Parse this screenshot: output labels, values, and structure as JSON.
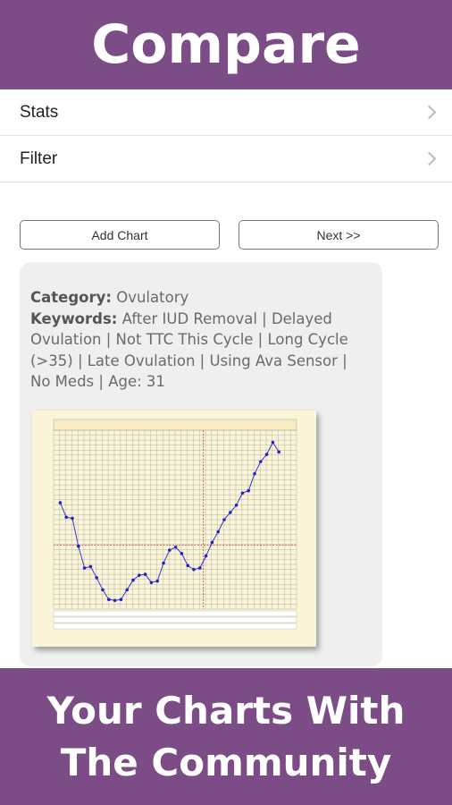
{
  "header": {
    "title": "Compare"
  },
  "menu": [
    {
      "label": "Stats"
    },
    {
      "label": "Filter"
    }
  ],
  "actions": {
    "add_chart": "Add Chart",
    "next": "Next >>"
  },
  "card": {
    "category_label": "Category:",
    "category_value": "Ovulatory",
    "keywords_label": "Keywords:",
    "keywords_value": "After IUD Removal | Delayed Ovulation | Not TTC This Cycle | Long Cycle (>35) | Late Ovulation | Using Ava Sensor | No Meds | Age: 31"
  },
  "chart_data": {
    "type": "line",
    "title": "",
    "values": [
      97.6,
      97.3,
      97.28,
      96.7,
      96.25,
      96.28,
      96.05,
      95.8,
      95.6,
      95.58,
      95.6,
      95.8,
      96.0,
      96.1,
      96.12,
      95.95,
      95.98,
      96.35,
      96.62,
      96.68,
      96.55,
      96.3,
      96.22,
      96.25,
      96.5,
      96.78,
      97.0,
      97.25,
      97.4,
      97.55,
      97.8,
      97.85,
      98.2,
      98.45,
      98.6,
      98.85,
      98.65
    ]
  },
  "footer": {
    "line1": "Your Charts With",
    "line2": "The Community"
  },
  "colors": {
    "brand": "#7b4c86",
    "card": "#efefef",
    "chart_bg": "#fbf5d8",
    "series": "#2222cc",
    "coverline": "#d04040"
  }
}
